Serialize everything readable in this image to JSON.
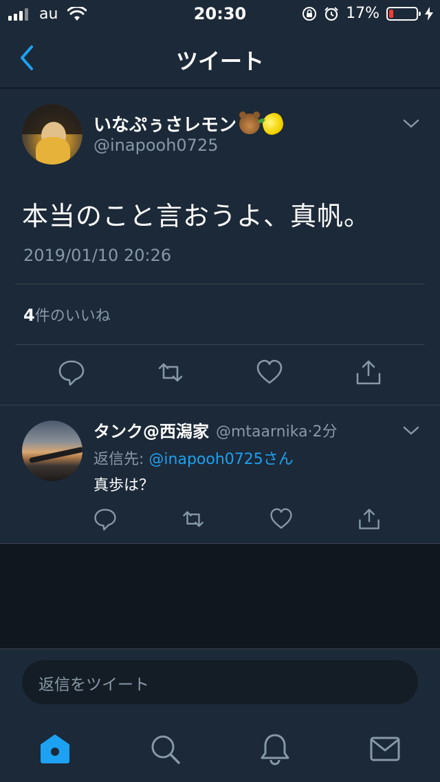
{
  "status": {
    "carrier": "au",
    "time": "20:30",
    "battery": "17%",
    "battery_level": 0.17
  },
  "nav": {
    "title": "ツイート"
  },
  "tweet": {
    "author_name": "いなぷぅさレモン",
    "author_handle": "@inapooh0725",
    "name_emojis": [
      "bear-emoji",
      "lemon-emoji"
    ],
    "text": "本当のこと言おうよ、真帆。",
    "timestamp": "2019/01/10 20:26",
    "likes_count": "4",
    "likes_label": "件のいいね"
  },
  "reply": {
    "author_name": "タンク@西潟家",
    "author_handle": "@mtaarnika",
    "time_ago": "2分",
    "reply_to_label": "返信先: ",
    "reply_to_handle": "@inapooh0725さん",
    "text": "真歩は？"
  },
  "compose": {
    "placeholder": "返信をツイート"
  },
  "icons": [
    "signal-icon",
    "wifi-icon",
    "rotation-lock-icon",
    "alarm-icon",
    "battery-icon",
    "charging-icon",
    "back-chevron-icon",
    "caret-down-icon",
    "reply-icon",
    "retweet-icon",
    "like-icon",
    "share-icon",
    "home-icon",
    "search-icon",
    "notifications-icon",
    "messages-icon"
  ],
  "colors": {
    "accent": "#1da1f2",
    "background": "#141d26",
    "card": "#1c2938",
    "muted": "#8899a6",
    "battery_low": "#ff3b30"
  }
}
